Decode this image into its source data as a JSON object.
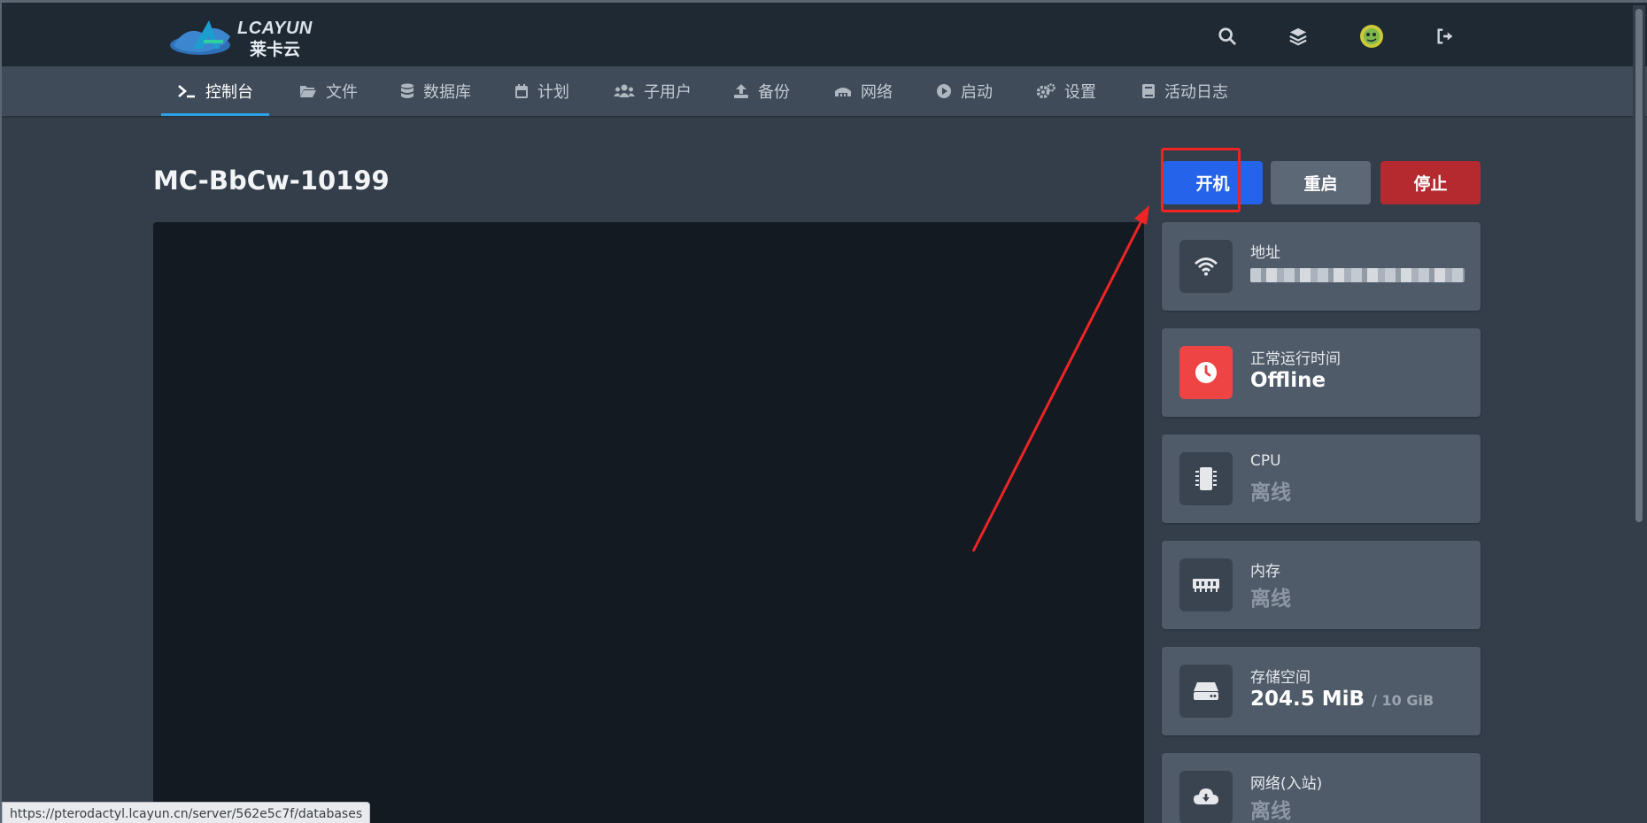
{
  "brand": {
    "name_en": "LCAYUN",
    "name_cn": "莱卡云"
  },
  "topbar": {
    "icons": [
      "search-icon",
      "layers-icon",
      "user-avatar",
      "sign-out-icon"
    ]
  },
  "nav": {
    "items": [
      {
        "label": "控制台",
        "icon": "terminal-icon",
        "active": true
      },
      {
        "label": "文件",
        "icon": "folder-icon"
      },
      {
        "label": "数据库",
        "icon": "database-icon"
      },
      {
        "label": "计划",
        "icon": "calendar-icon"
      },
      {
        "label": "子用户",
        "icon": "users-icon"
      },
      {
        "label": "备份",
        "icon": "upload-icon"
      },
      {
        "label": "网络",
        "icon": "network-icon"
      },
      {
        "label": "启动",
        "icon": "play-icon"
      },
      {
        "label": "设置",
        "icon": "cogs-icon"
      },
      {
        "label": "活动日志",
        "icon": "book-icon"
      }
    ]
  },
  "server": {
    "title": "MC-BbCw-10199"
  },
  "power": {
    "start_label": "开机",
    "restart_label": "重启",
    "stop_label": "停止"
  },
  "stats": {
    "address": {
      "label": "地址",
      "icon": "wifi-icon"
    },
    "uptime": {
      "label": "正常运行时间",
      "value": "Offline",
      "icon": "clock-icon"
    },
    "cpu": {
      "label": "CPU",
      "value": "离线",
      "icon": "microchip-icon"
    },
    "memory": {
      "label": "内存",
      "value": "离线",
      "icon": "memory-icon"
    },
    "storage": {
      "label": "存储空间",
      "value": "204.5 MiB",
      "limit": "/ 10 GiB",
      "icon": "hdd-icon"
    },
    "network_in": {
      "label": "网络(入站)",
      "value": "离线",
      "icon": "cloud-download-icon"
    }
  },
  "status_bar": {
    "url": "https://pterodactyl.lcayun.cn/server/562e5c7f/databases"
  },
  "colors": {
    "start": "#2563eb",
    "restart": "#5d6876",
    "stop": "#b42a2f",
    "highlight": "#f02424",
    "tab_underline": "#2ea1e6"
  }
}
